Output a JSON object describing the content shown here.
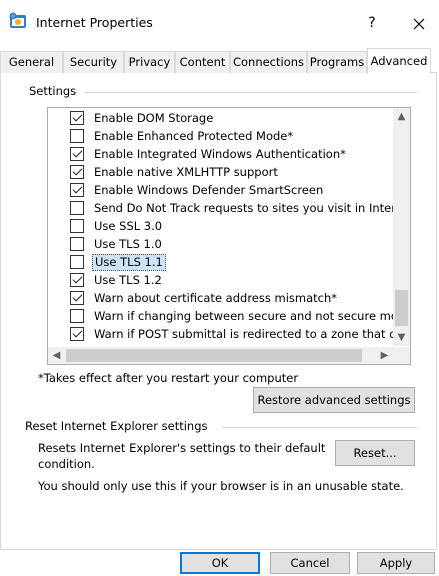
{
  "window": {
    "title": "Internet Properties",
    "help_label": "?",
    "close_label": "✕"
  },
  "tabs": [
    {
      "label": "General"
    },
    {
      "label": "Security"
    },
    {
      "label": "Privacy"
    },
    {
      "label": "Content"
    },
    {
      "label": "Connections"
    },
    {
      "label": "Programs"
    },
    {
      "label": "Advanced",
      "active": true
    }
  ],
  "settings": {
    "caption": "Settings",
    "items": [
      {
        "label": "Enable DOM Storage",
        "checked": true
      },
      {
        "label": "Enable Enhanced Protected Mode*",
        "checked": false
      },
      {
        "label": "Enable Integrated Windows Authentication*",
        "checked": true
      },
      {
        "label": "Enable native XMLHTTP support",
        "checked": true
      },
      {
        "label": "Enable Windows Defender SmartScreen",
        "checked": true
      },
      {
        "label": "Send Do Not Track requests to sites you visit in Internet E",
        "checked": false
      },
      {
        "label": "Use SSL 3.0",
        "checked": false
      },
      {
        "label": "Use TLS 1.0",
        "checked": false
      },
      {
        "label": "Use TLS 1.1",
        "checked": false,
        "selected": true
      },
      {
        "label": "Use TLS 1.2",
        "checked": true
      },
      {
        "label": "Warn about certificate address mismatch*",
        "checked": true
      },
      {
        "label": "Warn if changing between secure and not secure mode",
        "checked": false
      },
      {
        "label": "Warn if POST submittal is redirected to a zone that does n",
        "checked": true
      }
    ],
    "note": "*Takes effect after you restart your computer",
    "restore_button": "Restore advanced settings"
  },
  "reset": {
    "caption": "Reset Internet Explorer settings",
    "description_line1": "Resets Internet Explorer's settings to their default",
    "description_line2": "condition.",
    "button": "Reset...",
    "warning": "You should only use this if your browser is in an unusable state."
  },
  "footer": {
    "ok": "OK",
    "cancel": "Cancel",
    "apply": "Apply"
  },
  "colors": {
    "selection": "#cce4f7",
    "default_button_border": "#0078d7"
  }
}
